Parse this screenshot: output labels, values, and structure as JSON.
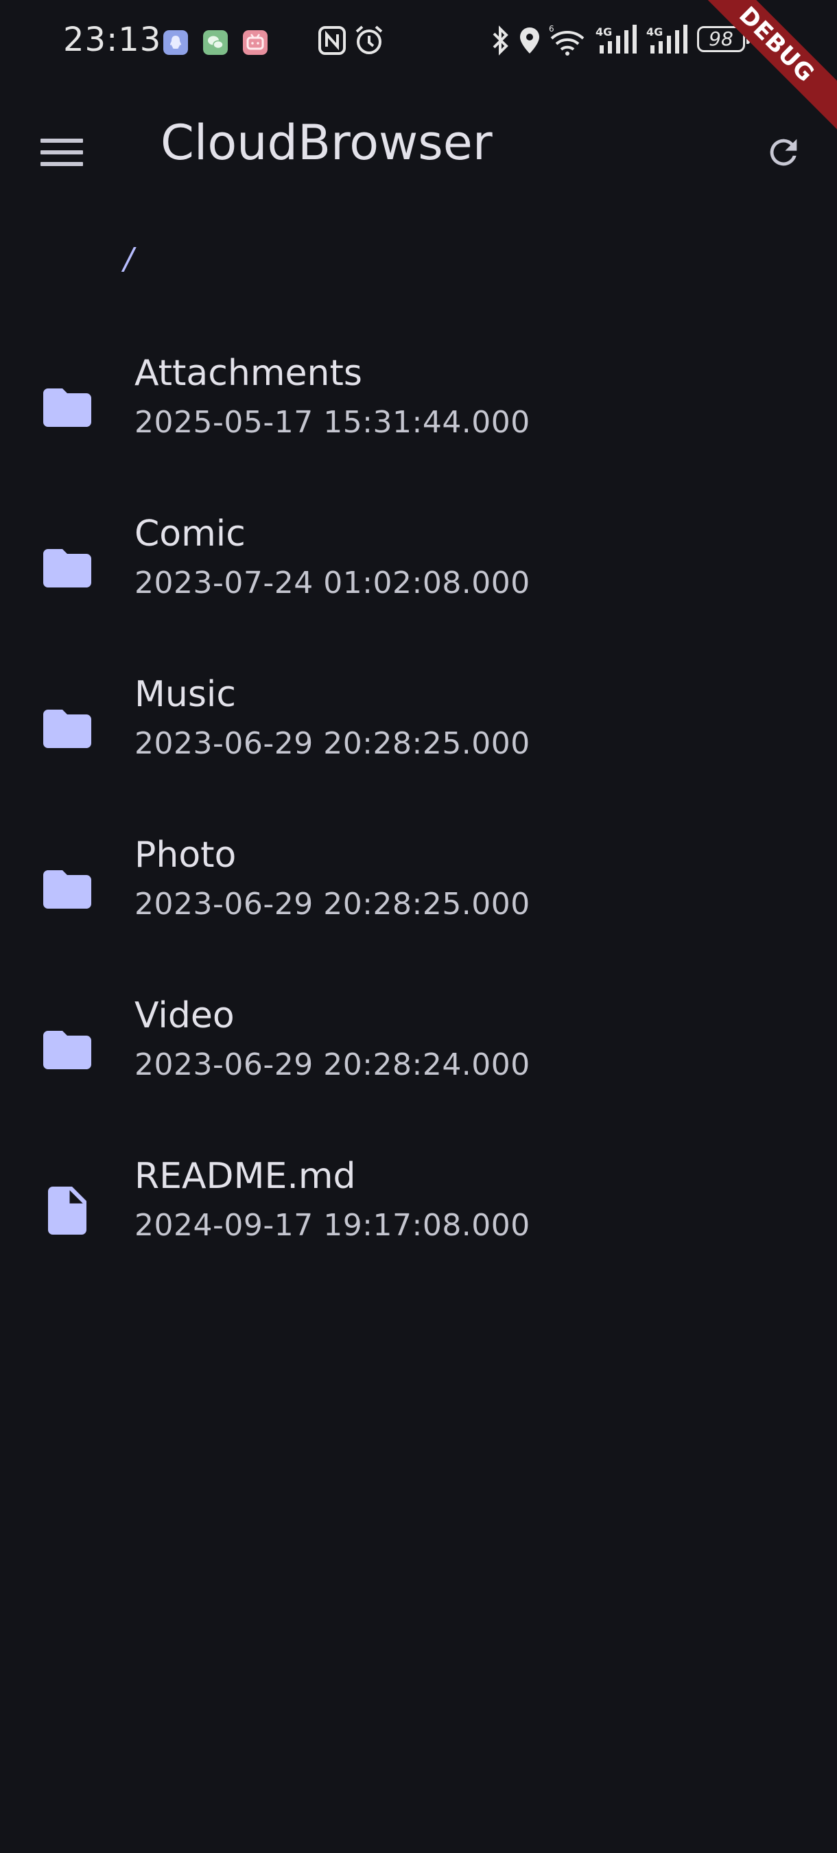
{
  "status_bar": {
    "time": "23:13",
    "battery": "98",
    "colors": {
      "notif_qq": "#8FA2E8",
      "notif_wechat": "#7FBF8A",
      "notif_bilibili": "#E8909E"
    }
  },
  "debug_banner": "DEBUG",
  "app_bar": {
    "title": "CloudBrowser",
    "menu_icon": "hamburger-menu-icon",
    "refresh_icon": "refresh-icon"
  },
  "breadcrumb": {
    "path": "/"
  },
  "files": [
    {
      "name": "Attachments",
      "modified": "2025-05-17 15:31:44.000",
      "type": "folder"
    },
    {
      "name": "Comic",
      "modified": "2023-07-24 01:02:08.000",
      "type": "folder"
    },
    {
      "name": "Music",
      "modified": "2023-06-29 20:28:25.000",
      "type": "folder"
    },
    {
      "name": "Photo",
      "modified": "2023-06-29 20:28:25.000",
      "type": "folder"
    },
    {
      "name": "Video",
      "modified": "2023-06-29 20:28:24.000",
      "type": "folder"
    },
    {
      "name": "README.md",
      "modified": "2024-09-17 19:17:08.000",
      "type": "file"
    }
  ],
  "colors": {
    "background": "#121318",
    "accent": "#B7BDFF",
    "text_primary": "#E3E2EA",
    "text_secondary": "#C5C6D0",
    "debug_banner": "#8E1B1F"
  }
}
